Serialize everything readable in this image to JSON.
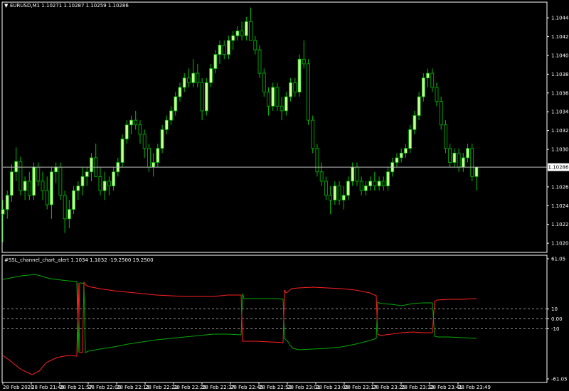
{
  "main_chart": {
    "symbol_label": "EURUSD,M1 1.10271 1.10287 1.10259 1.10286",
    "bid_label": "1.10286",
    "y_ticks": [
      "1.10445",
      "1.10425",
      "1.10405",
      "1.10385",
      "1.10365",
      "1.10345",
      "1.10325",
      "1.10305",
      "1.10265",
      "1.10245",
      "1.10225",
      "1.10205"
    ]
  },
  "indicator": {
    "label": "#SSL_channel_chart_alert 1.1034 1.1032 -19.2500 19.2500",
    "y_ticks": [
      "61.05",
      "10",
      "0.00",
      "-10",
      "-61.05"
    ]
  },
  "time_axis": [
    "28 Feb 2020",
    "28 Feb 21:49",
    "28 Feb 21:57",
    "28 Feb 22:05",
    "28 Feb 22:13",
    "28 Feb 22:21",
    "28 Feb 22:29",
    "28 Feb 22:37",
    "28 Feb 22:45",
    "28 Feb 22:53",
    "28 Feb 23:01",
    "28 Feb 23:09",
    "28 Feb 23:17",
    "28 Feb 23:25",
    "28 Feb 23:33",
    "28 Feb 23:41",
    "28 Feb 23:49"
  ],
  "colors": {
    "background": "#000000",
    "bull_candle": "#ccff99",
    "bear_candle": "#000000",
    "wick": "#00c000",
    "grid_line": "#c0c0c0",
    "ssl_green": "#00aa00",
    "ssl_red": "#ff2020",
    "level_line": "#c0c0c0",
    "bid_box": "#ffffff"
  },
  "chart_data": {
    "type": "candlestick",
    "title": "EURUSD,M1 1.10271 1.10287 1.10259 1.10286",
    "ylim": [
      1.10196,
      1.10461
    ],
    "candles": [
      {
        "o": 1.10236,
        "h": 1.10251,
        "l": 1.10206,
        "c": 1.10241
      },
      {
        "o": 1.10241,
        "h": 1.10261,
        "l": 1.10231,
        "c": 1.10256
      },
      {
        "o": 1.10256,
        "h": 1.10289,
        "l": 1.10249,
        "c": 1.10281
      },
      {
        "o": 1.10281,
        "h": 1.10307,
        "l": 1.10271,
        "c": 1.10292
      },
      {
        "o": 1.10292,
        "h": 1.10297,
        "l": 1.10256,
        "c": 1.10261
      },
      {
        "o": 1.10261,
        "h": 1.10276,
        "l": 1.10251,
        "c": 1.10271
      },
      {
        "o": 1.10271,
        "h": 1.10281,
        "l": 1.10251,
        "c": 1.10256
      },
      {
        "o": 1.10256,
        "h": 1.10291,
        "l": 1.10251,
        "c": 1.10286
      },
      {
        "o": 1.10286,
        "h": 1.10291,
        "l": 1.10266,
        "c": 1.10271
      },
      {
        "o": 1.10271,
        "h": 1.10281,
        "l": 1.10251,
        "c": 1.10261
      },
      {
        "o": 1.10261,
        "h": 1.10276,
        "l": 1.10241,
        "c": 1.10246
      },
      {
        "o": 1.10246,
        "h": 1.10286,
        "l": 1.10231,
        "c": 1.10281
      },
      {
        "o": 1.10281,
        "h": 1.10291,
        "l": 1.10269,
        "c": 1.10286
      },
      {
        "o": 1.10286,
        "h": 1.10291,
        "l": 1.10251,
        "c": 1.10256
      },
      {
        "o": 1.10256,
        "h": 1.10261,
        "l": 1.10216,
        "c": 1.10231
      },
      {
        "o": 1.10231,
        "h": 1.10251,
        "l": 1.10221,
        "c": 1.10241
      },
      {
        "o": 1.10241,
        "h": 1.10266,
        "l": 1.10236,
        "c": 1.10261
      },
      {
        "o": 1.10261,
        "h": 1.10271,
        "l": 1.10251,
        "c": 1.10266
      },
      {
        "o": 1.10266,
        "h": 1.10286,
        "l": 1.10256,
        "c": 1.10276
      },
      {
        "o": 1.10276,
        "h": 1.10286,
        "l": 1.10266,
        "c": 1.10281
      },
      {
        "o": 1.10281,
        "h": 1.10301,
        "l": 1.10271,
        "c": 1.10296
      },
      {
        "o": 1.10296,
        "h": 1.10311,
        "l": 1.10281,
        "c": 1.10276
      },
      {
        "o": 1.10276,
        "h": 1.10286,
        "l": 1.10256,
        "c": 1.10261
      },
      {
        "o": 1.10261,
        "h": 1.10281,
        "l": 1.10251,
        "c": 1.10271
      },
      {
        "o": 1.10271,
        "h": 1.10276,
        "l": 1.10256,
        "c": 1.10266
      },
      {
        "o": 1.10266,
        "h": 1.10286,
        "l": 1.10261,
        "c": 1.10281
      },
      {
        "o": 1.10281,
        "h": 1.10296,
        "l": 1.10276,
        "c": 1.10291
      },
      {
        "o": 1.10291,
        "h": 1.10321,
        "l": 1.10286,
        "c": 1.10316
      },
      {
        "o": 1.10316,
        "h": 1.10336,
        "l": 1.10311,
        "c": 1.10331
      },
      {
        "o": 1.10331,
        "h": 1.10341,
        "l": 1.10321,
        "c": 1.10336
      },
      {
        "o": 1.10336,
        "h": 1.10346,
        "l": 1.10326,
        "c": 1.10331
      },
      {
        "o": 1.10331,
        "h": 1.10336,
        "l": 1.10311,
        "c": 1.10321
      },
      {
        "o": 1.10321,
        "h": 1.10326,
        "l": 1.10296,
        "c": 1.10306
      },
      {
        "o": 1.10306,
        "h": 1.10311,
        "l": 1.10281,
        "c": 1.10286
      },
      {
        "o": 1.10286,
        "h": 1.10301,
        "l": 1.10276,
        "c": 1.10291
      },
      {
        "o": 1.10291,
        "h": 1.10311,
        "l": 1.10286,
        "c": 1.10306
      },
      {
        "o": 1.10306,
        "h": 1.10331,
        "l": 1.10301,
        "c": 1.10326
      },
      {
        "o": 1.10326,
        "h": 1.10341,
        "l": 1.10321,
        "c": 1.10336
      },
      {
        "o": 1.10336,
        "h": 1.10351,
        "l": 1.10331,
        "c": 1.10346
      },
      {
        "o": 1.10346,
        "h": 1.10366,
        "l": 1.10341,
        "c": 1.10361
      },
      {
        "o": 1.10361,
        "h": 1.10376,
        "l": 1.10356,
        "c": 1.10371
      },
      {
        "o": 1.10371,
        "h": 1.10386,
        "l": 1.10366,
        "c": 1.10381
      },
      {
        "o": 1.10381,
        "h": 1.10391,
        "l": 1.10371,
        "c": 1.10376
      },
      {
        "o": 1.10376,
        "h": 1.10401,
        "l": 1.10371,
        "c": 1.10386
      },
      {
        "o": 1.10386,
        "h": 1.10396,
        "l": 1.10371,
        "c": 1.10376
      },
      {
        "o": 1.10376,
        "h": 1.10381,
        "l": 1.10336,
        "c": 1.10346
      },
      {
        "o": 1.10346,
        "h": 1.10381,
        "l": 1.10341,
        "c": 1.10376
      },
      {
        "o": 1.10376,
        "h": 1.10396,
        "l": 1.10371,
        "c": 1.10391
      },
      {
        "o": 1.10391,
        "h": 1.10411,
        "l": 1.10386,
        "c": 1.10406
      },
      {
        "o": 1.10406,
        "h": 1.10421,
        "l": 1.10396,
        "c": 1.10416
      },
      {
        "o": 1.10416,
        "h": 1.10421,
        "l": 1.10401,
        "c": 1.10406
      },
      {
        "o": 1.10406,
        "h": 1.10426,
        "l": 1.10401,
        "c": 1.10421
      },
      {
        "o": 1.10421,
        "h": 1.10431,
        "l": 1.10411,
        "c": 1.10426
      },
      {
        "o": 1.10426,
        "h": 1.10436,
        "l": 1.10421,
        "c": 1.10431
      },
      {
        "o": 1.10431,
        "h": 1.10441,
        "l": 1.10421,
        "c": 1.10426
      },
      {
        "o": 1.10426,
        "h": 1.10446,
        "l": 1.10421,
        "c": 1.10441
      },
      {
        "o": 1.10441,
        "h": 1.10456,
        "l": 1.10421,
        "c": 1.10421
      },
      {
        "o": 1.10421,
        "h": 1.10426,
        "l": 1.10406,
        "c": 1.10411
      },
      {
        "o": 1.10411,
        "h": 1.10416,
        "l": 1.10381,
        "c": 1.10386
      },
      {
        "o": 1.10386,
        "h": 1.10391,
        "l": 1.10361,
        "c": 1.10366
      },
      {
        "o": 1.10366,
        "h": 1.10371,
        "l": 1.10341,
        "c": 1.10351
      },
      {
        "o": 1.10351,
        "h": 1.10376,
        "l": 1.10346,
        "c": 1.10371
      },
      {
        "o": 1.10371,
        "h": 1.10376,
        "l": 1.10346,
        "c": 1.10351
      },
      {
        "o": 1.10351,
        "h": 1.10361,
        "l": 1.10336,
        "c": 1.10346
      },
      {
        "o": 1.10346,
        "h": 1.10366,
        "l": 1.10341,
        "c": 1.10361
      },
      {
        "o": 1.10361,
        "h": 1.10381,
        "l": 1.10356,
        "c": 1.10376
      },
      {
        "o": 1.10376,
        "h": 1.10381,
        "l": 1.10361,
        "c": 1.10366
      },
      {
        "o": 1.10366,
        "h": 1.10406,
        "l": 1.10361,
        "c": 1.10401
      },
      {
        "o": 1.10401,
        "h": 1.10421,
        "l": 1.10391,
        "c": 1.10396
      },
      {
        "o": 1.10396,
        "h": 1.10401,
        "l": 1.10331,
        "c": 1.10336
      },
      {
        "o": 1.10336,
        "h": 1.10341,
        "l": 1.10301,
        "c": 1.10306
      },
      {
        "o": 1.10306,
        "h": 1.10311,
        "l": 1.10276,
        "c": 1.10281
      },
      {
        "o": 1.10281,
        "h": 1.10291,
        "l": 1.10266,
        "c": 1.10271
      },
      {
        "o": 1.10271,
        "h": 1.10276,
        "l": 1.10251,
        "c": 1.10256
      },
      {
        "o": 1.10256,
        "h": 1.10266,
        "l": 1.10236,
        "c": 1.10251
      },
      {
        "o": 1.10251,
        "h": 1.10271,
        "l": 1.10246,
        "c": 1.10266
      },
      {
        "o": 1.10266,
        "h": 1.10271,
        "l": 1.10246,
        "c": 1.10251
      },
      {
        "o": 1.10251,
        "h": 1.10266,
        "l": 1.10241,
        "c": 1.10256
      },
      {
        "o": 1.10256,
        "h": 1.10276,
        "l": 1.10251,
        "c": 1.10271
      },
      {
        "o": 1.10271,
        "h": 1.10291,
        "l": 1.10266,
        "c": 1.10286
      },
      {
        "o": 1.10286,
        "h": 1.10291,
        "l": 1.10266,
        "c": 1.10271
      },
      {
        "o": 1.10271,
        "h": 1.10276,
        "l": 1.10256,
        "c": 1.10261
      },
      {
        "o": 1.10261,
        "h": 1.10271,
        "l": 1.10256,
        "c": 1.10266
      },
      {
        "o": 1.10266,
        "h": 1.10276,
        "l": 1.10261,
        "c": 1.10271
      },
      {
        "o": 1.10271,
        "h": 1.10281,
        "l": 1.10261,
        "c": 1.10266
      },
      {
        "o": 1.10266,
        "h": 1.10276,
        "l": 1.10261,
        "c": 1.10271
      },
      {
        "o": 1.10271,
        "h": 1.10276,
        "l": 1.10261,
        "c": 1.10266
      },
      {
        "o": 1.10266,
        "h": 1.10286,
        "l": 1.10261,
        "c": 1.10281
      },
      {
        "o": 1.10281,
        "h": 1.10296,
        "l": 1.10276,
        "c": 1.10291
      },
      {
        "o": 1.10291,
        "h": 1.10301,
        "l": 1.10286,
        "c": 1.10296
      },
      {
        "o": 1.10296,
        "h": 1.10306,
        "l": 1.10291,
        "c": 1.10301
      },
      {
        "o": 1.10301,
        "h": 1.10311,
        "l": 1.10296,
        "c": 1.10306
      },
      {
        "o": 1.10306,
        "h": 1.10331,
        "l": 1.10301,
        "c": 1.10326
      },
      {
        "o": 1.10326,
        "h": 1.10346,
        "l": 1.10321,
        "c": 1.10341
      },
      {
        "o": 1.10341,
        "h": 1.10366,
        "l": 1.10336,
        "c": 1.10361
      },
      {
        "o": 1.10361,
        "h": 1.10386,
        "l": 1.10356,
        "c": 1.10381
      },
      {
        "o": 1.10381,
        "h": 1.10391,
        "l": 1.10371,
        "c": 1.10386
      },
      {
        "o": 1.10386,
        "h": 1.10391,
        "l": 1.10366,
        "c": 1.10371
      },
      {
        "o": 1.10371,
        "h": 1.10376,
        "l": 1.10351,
        "c": 1.10356
      },
      {
        "o": 1.10356,
        "h": 1.10361,
        "l": 1.10326,
        "c": 1.10331
      },
      {
        "o": 1.10331,
        "h": 1.10336,
        "l": 1.10301,
        "c": 1.10306
      },
      {
        "o": 1.10306,
        "h": 1.10311,
        "l": 1.10286,
        "c": 1.10291
      },
      {
        "o": 1.10291,
        "h": 1.10306,
        "l": 1.10286,
        "c": 1.10301
      },
      {
        "o": 1.10301,
        "h": 1.10306,
        "l": 1.10281,
        "c": 1.10286
      },
      {
        "o": 1.10286,
        "h": 1.10301,
        "l": 1.10281,
        "c": 1.10296
      },
      {
        "o": 1.10296,
        "h": 1.10311,
        "l": 1.10291,
        "c": 1.10306
      },
      {
        "o": 1.10306,
        "h": 1.10311,
        "l": 1.10271,
        "c": 1.10276
      },
      {
        "o": 1.10276,
        "h": 1.10286,
        "l": 1.10261,
        "c": 1.10286
      }
    ],
    "bid_price": 1.10286,
    "indicator": {
      "name": "#SSL_channel_chart_alert",
      "ylim": [
        -61.05,
        61.05
      ],
      "levels": [
        10,
        0,
        -10
      ]
    }
  }
}
